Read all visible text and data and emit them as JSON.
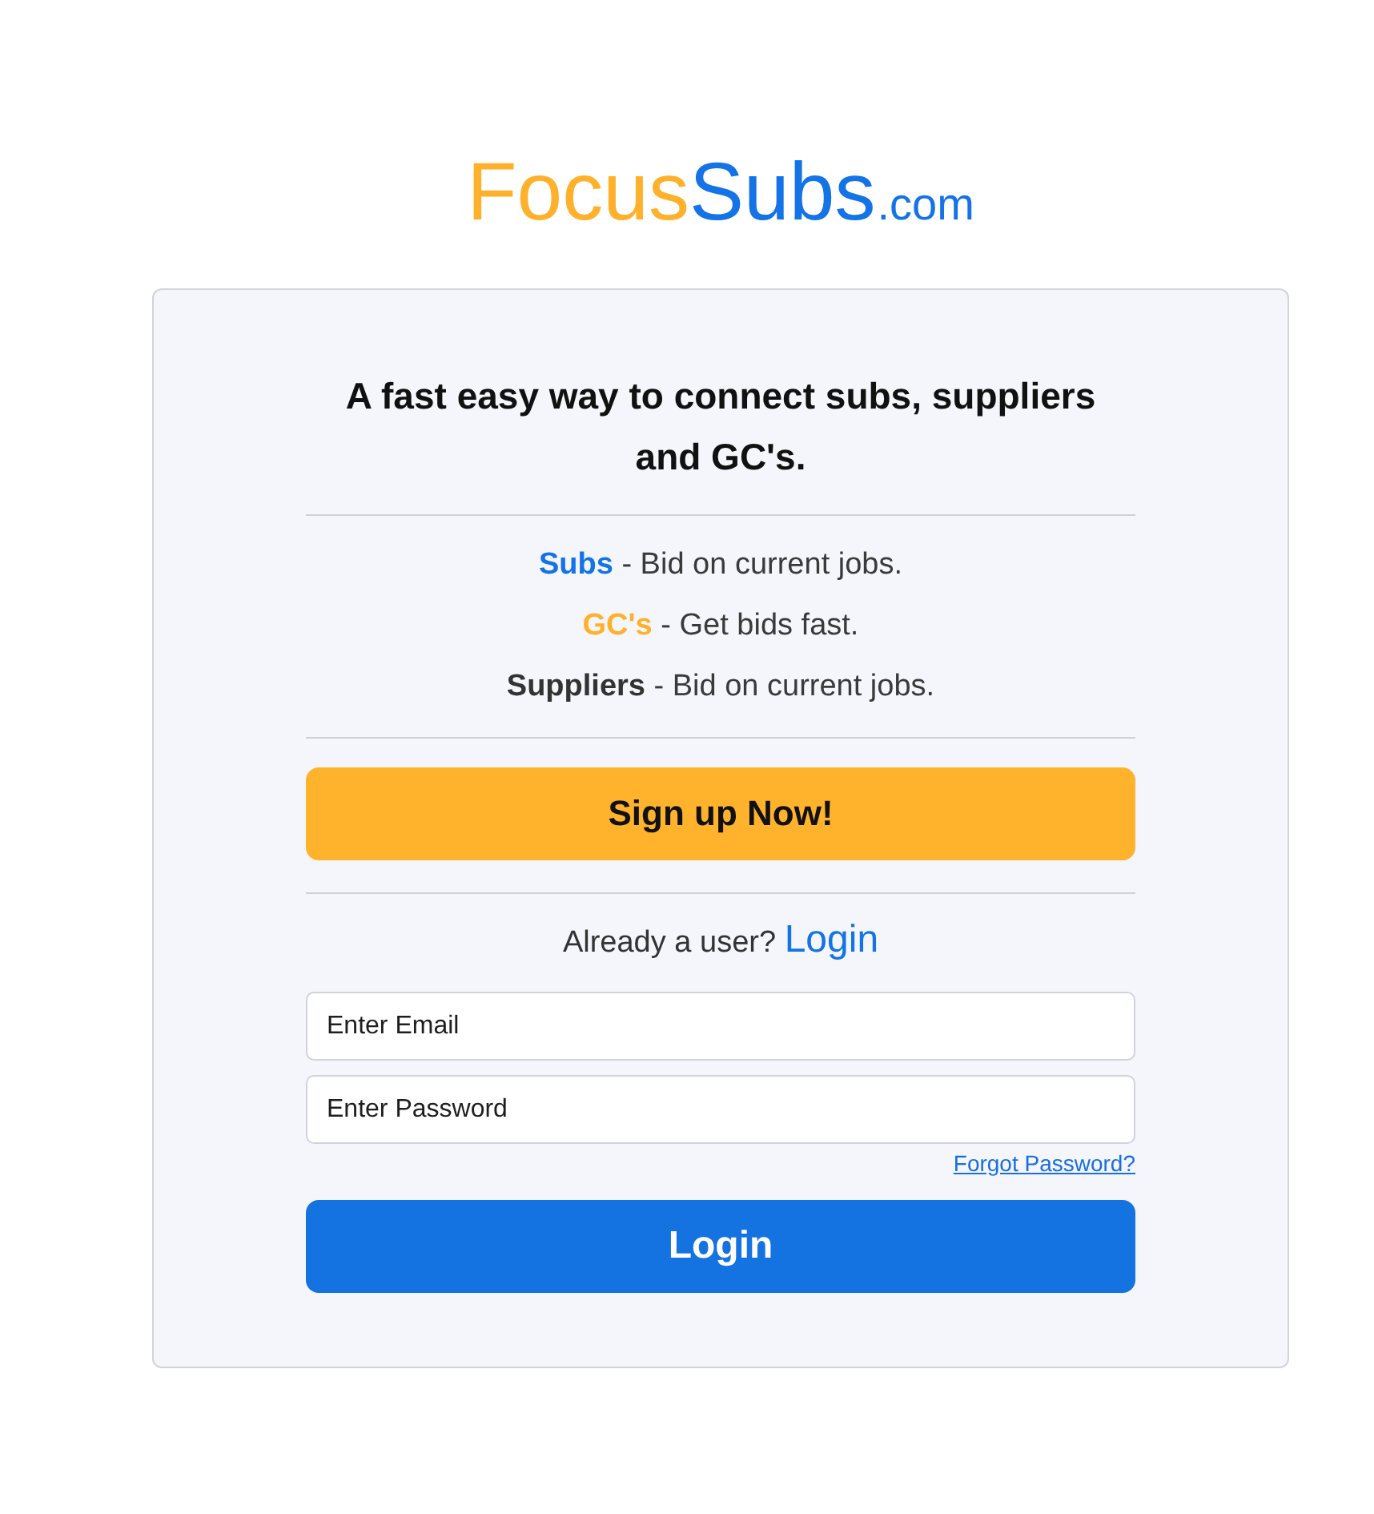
{
  "logo": {
    "parts": [
      {
        "text": "Focus",
        "color": "#ffb12b",
        "kind": "name"
      },
      {
        "text": "Subs",
        "color": "#1473e6",
        "kind": "name"
      },
      {
        "text": ".com",
        "color": "#1473e6",
        "kind": "suffix"
      }
    ]
  },
  "card": {
    "heading": "A fast easy way to connect subs, suppliers and GC's.",
    "features": [
      {
        "term": "Subs",
        "text": "- Bid on current jobs.",
        "color": "#1473e6"
      },
      {
        "term": "GC's",
        "text": "- Get bids fast.",
        "color": "#ffb12b"
      },
      {
        "term": "Suppliers",
        "text": "- Bid on current jobs.",
        "color": "#333333"
      }
    ],
    "signup_button": "Sign up Now!",
    "login_prompt": {
      "text": "Already a user?",
      "link": "Login"
    },
    "email_field": {
      "placeholder": "Enter Email"
    },
    "password_field": {
      "placeholder": "Enter Password"
    },
    "forgot_link": "Forgot Password?",
    "login_button": "Login"
  }
}
